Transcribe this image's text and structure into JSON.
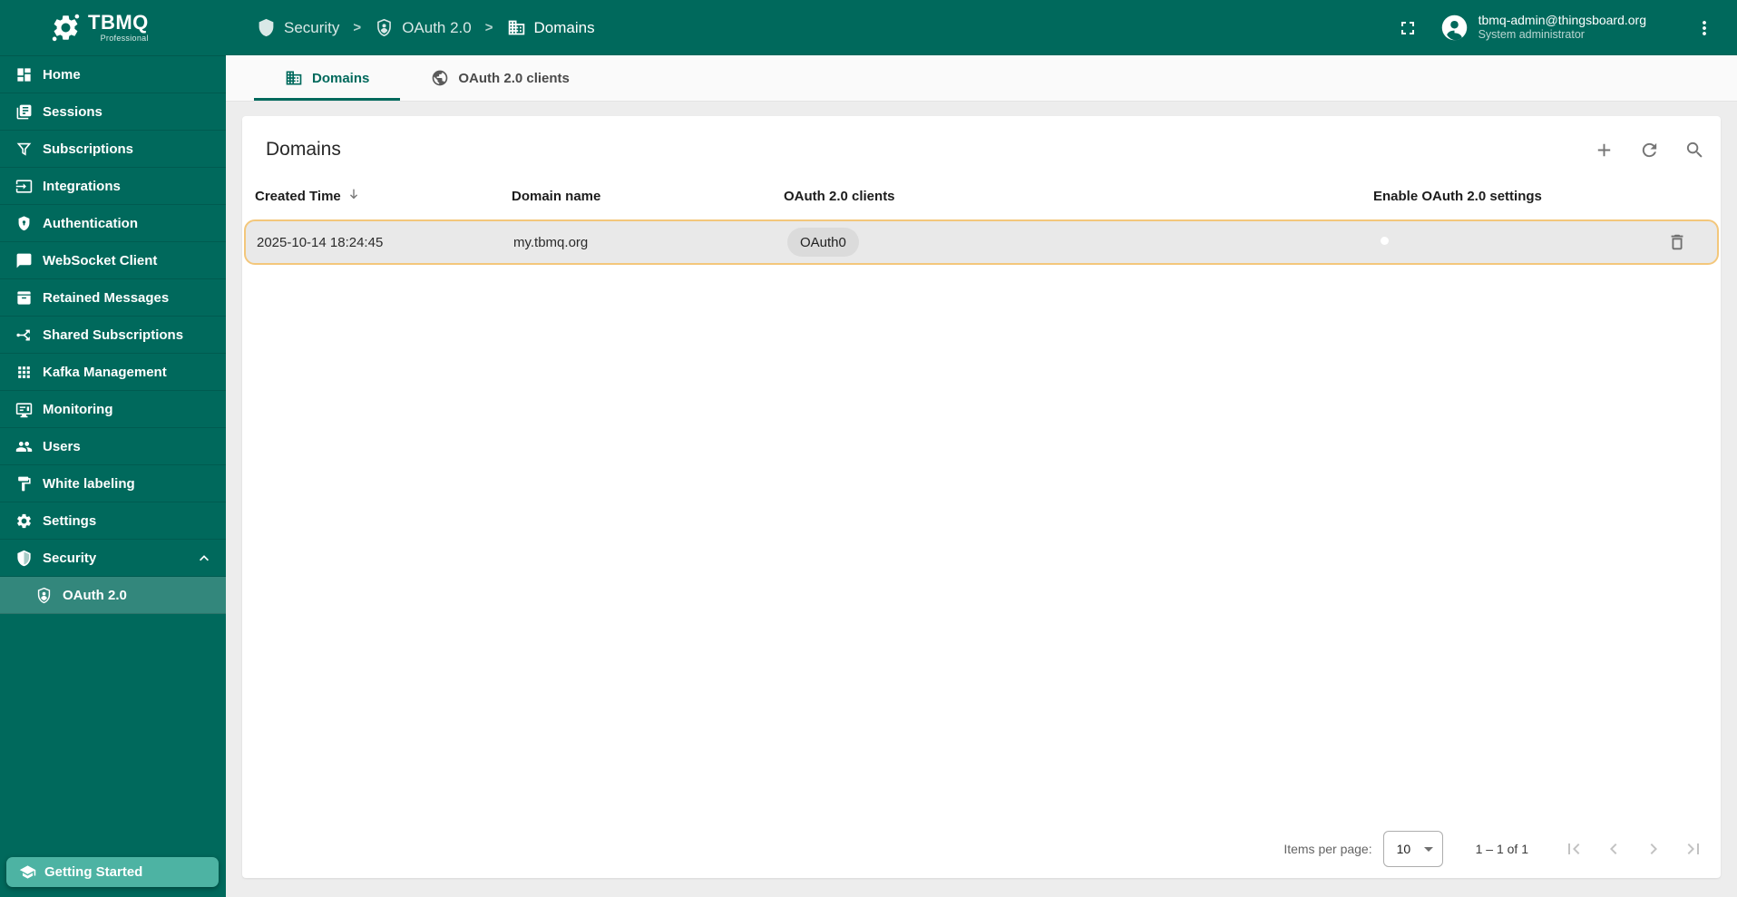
{
  "app": {
    "name": "TBMQ",
    "edition": "Professional"
  },
  "header": {
    "separator": ">",
    "breadcrumb": [
      {
        "label": "Security",
        "icon": "shield-icon"
      },
      {
        "label": "OAuth 2.0",
        "icon": "user-shield-icon"
      },
      {
        "label": "Domains",
        "icon": "domain-icon"
      }
    ],
    "user": {
      "email": "tbmq-admin@thingsboard.org",
      "role": "System administrator"
    },
    "icons": {
      "fullscreen": "fullscreen-icon",
      "account": "account-circle-icon",
      "menu": "more-vert-icon"
    }
  },
  "sidebar": {
    "items": [
      {
        "label": "Home",
        "icon": "dashboard-icon"
      },
      {
        "label": "Sessions",
        "icon": "library-icon"
      },
      {
        "label": "Subscriptions",
        "icon": "filter-icon"
      },
      {
        "label": "Integrations",
        "icon": "input-icon"
      },
      {
        "label": "Authentication",
        "icon": "shield-lock-icon"
      },
      {
        "label": "WebSocket Client",
        "icon": "chat-icon"
      },
      {
        "label": "Retained Messages",
        "icon": "archive-icon"
      },
      {
        "label": "Shared Subscriptions",
        "icon": "split-icon"
      },
      {
        "label": "Kafka Management",
        "icon": "apps-grid-icon"
      },
      {
        "label": "Monitoring",
        "icon": "monitor-icon"
      },
      {
        "label": "Users",
        "icon": "people-icon"
      },
      {
        "label": "White labeling",
        "icon": "paint-icon"
      },
      {
        "label": "Settings",
        "icon": "gear-icon"
      },
      {
        "label": "Security",
        "icon": "shield-icon",
        "expanded": true
      }
    ],
    "security_subitems": [
      {
        "label": "OAuth 2.0",
        "icon": "user-shield-icon",
        "selected": true
      }
    ],
    "getting_started": {
      "label": "Getting Started",
      "icon": "school-icon"
    }
  },
  "tabs": [
    {
      "label": "Domains",
      "icon": "domain-icon",
      "active": true
    },
    {
      "label": "OAuth 2.0 clients",
      "icon": "globe-icon",
      "active": false
    }
  ],
  "panel": {
    "title": "Domains",
    "toolbar": {
      "add": "add-icon",
      "refresh": "refresh-icon",
      "search": "search-icon"
    },
    "columns": {
      "created_time": "Created Time",
      "domain_name": "Domain name",
      "clients": "OAuth 2.0 clients",
      "enable": "Enable OAuth 2.0 settings"
    },
    "sort": {
      "column": "created_time",
      "direction": "desc"
    },
    "rows": [
      {
        "created_time": "2025-10-14 18:24:45",
        "domain_name": "my.tbmq.org",
        "client_chips": [
          "OAuth0"
        ],
        "oauth_enabled": true,
        "highlighted": true
      }
    ]
  },
  "pagination": {
    "items_per_page_label": "Items per page:",
    "items_per_page": "10",
    "range_label": "1 – 1 of 1"
  },
  "colors": {
    "primary": "#00695c",
    "sidebar_selected_bg": "#33867a",
    "getting_started_bg": "#4db3a3",
    "row_highlight_border": "#f3c77b",
    "row_bg": "#e9e9e9",
    "content_bg": "#ededed"
  }
}
